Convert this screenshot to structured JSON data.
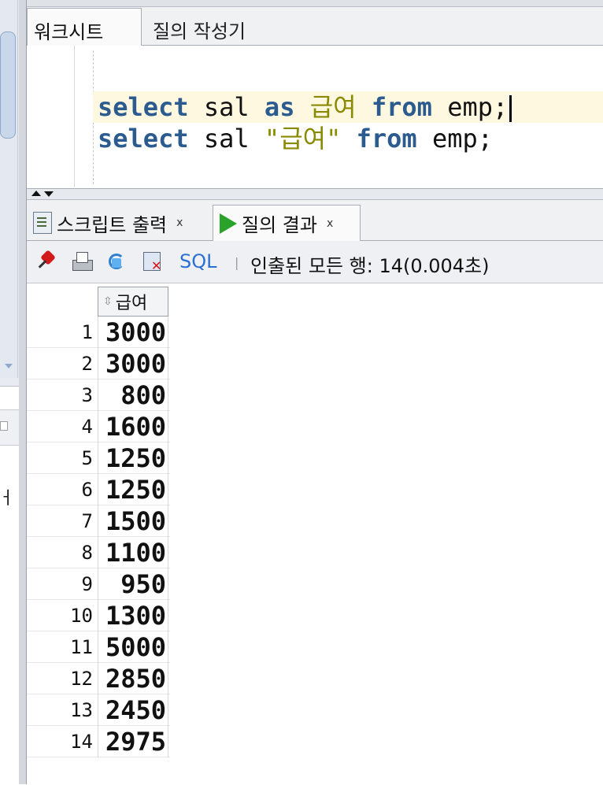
{
  "worksheet_tabs": {
    "worksheet": "워크시트",
    "query_builder": "질의 작성기"
  },
  "editor": {
    "line1": {
      "kw1": "select",
      "plain1": " sal ",
      "kw2": "as",
      "sp": " ",
      "hangul": "급여",
      "sp2": " ",
      "kw3": "from",
      "plain2": " emp;"
    },
    "line2": {
      "kw1": "select",
      "plain1": " sal ",
      "str": "\"급여\"",
      "sp": " ",
      "kw2": "from",
      "plain2": " emp;"
    }
  },
  "result_tabs": {
    "script_output": "스크립트 출력",
    "query_result": "질의 결과",
    "close": "x"
  },
  "toolbar": {
    "sql_label": "SQL",
    "separator": "|",
    "fetched_text": "인출된 모든 행: 14(0.004초)"
  },
  "grid": {
    "column_header": "급여",
    "rows": [
      {
        "num": "1",
        "value": "3000"
      },
      {
        "num": "2",
        "value": "3000"
      },
      {
        "num": "3",
        "value": "800"
      },
      {
        "num": "4",
        "value": "1600"
      },
      {
        "num": "5",
        "value": "1250"
      },
      {
        "num": "6",
        "value": "1250"
      },
      {
        "num": "7",
        "value": "1500"
      },
      {
        "num": "8",
        "value": "1100"
      },
      {
        "num": "9",
        "value": "950"
      },
      {
        "num": "10",
        "value": "1300"
      },
      {
        "num": "11",
        "value": "5000"
      },
      {
        "num": "12",
        "value": "2850"
      },
      {
        "num": "13",
        "value": "2450"
      },
      {
        "num": "14",
        "value": "2975"
      }
    ]
  },
  "left_clip_text": "ㅓ",
  "colors": {
    "keyword": "#2b5b8f",
    "hangul": "#8a8a00",
    "current_line": "#fff8e1",
    "sql_link": "#2a6fd3",
    "play": "#29a329"
  }
}
